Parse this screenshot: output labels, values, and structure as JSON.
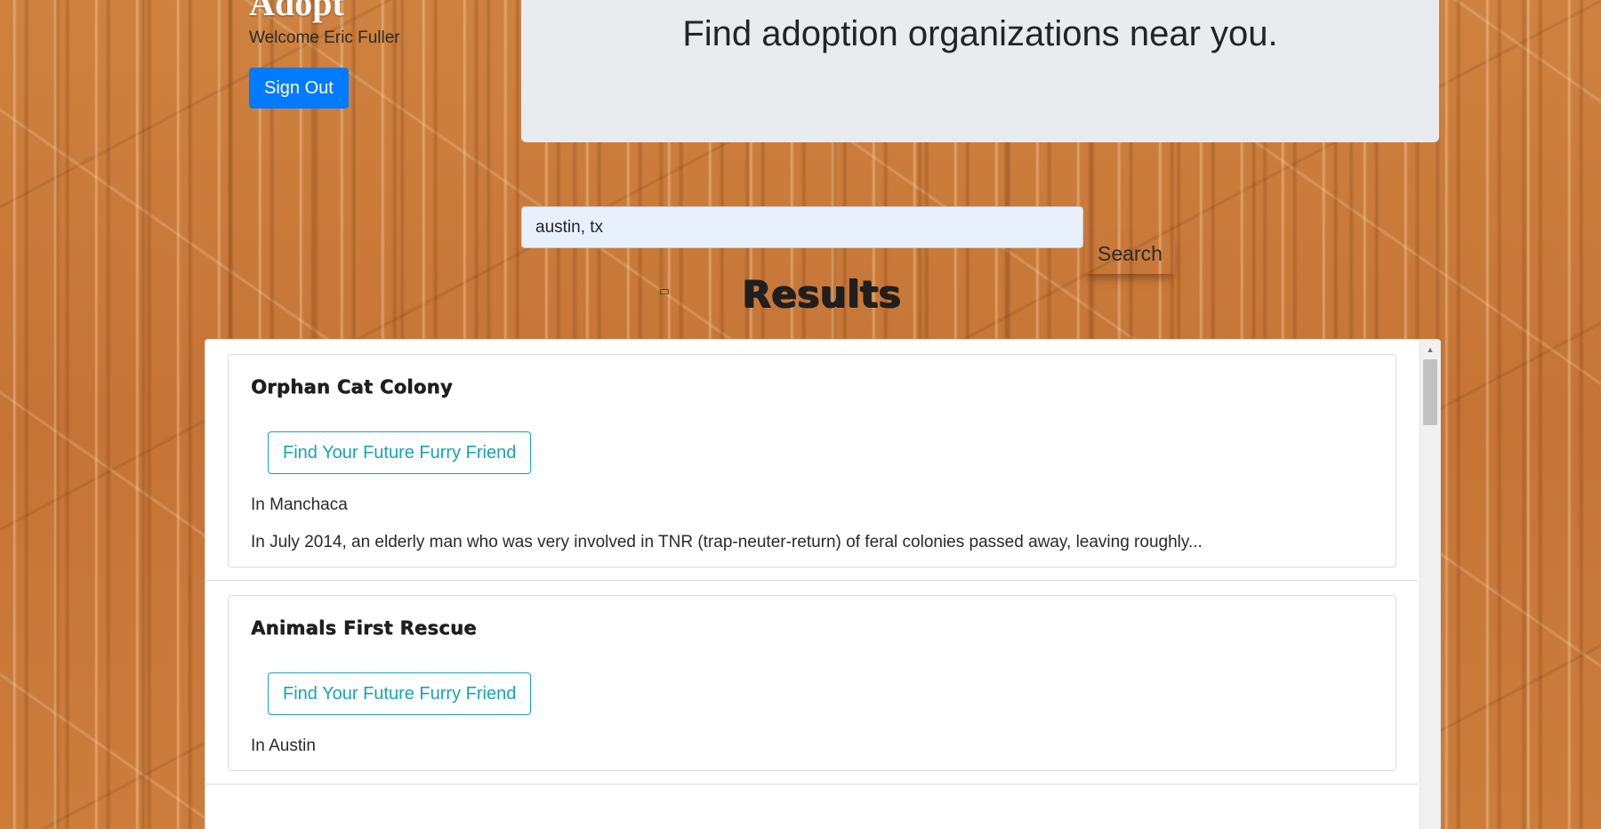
{
  "header": {
    "brand_title": "Adopt",
    "welcome_text": "Welcome Eric Fuller",
    "signout_label": "Sign Out"
  },
  "jumbotron": {
    "text": "Find adoption organizations near you."
  },
  "search": {
    "value": "austin, tx",
    "button_label": "Search"
  },
  "results": {
    "heading": "Results",
    "items": [
      {
        "name": "Orphan Cat Colony",
        "button_label": "Find Your Future Furry Friend",
        "location": "In Manchaca",
        "description": "In July 2014, an elderly man who was very involved in TNR (trap-neuter-return) of feral colonies passed away, leaving roughly..."
      },
      {
        "name": "Animals First Rescue",
        "button_label": "Find Your Future Furry Friend",
        "location": "In Austin"
      }
    ]
  },
  "scrollbar": {
    "up_arrow": "▲"
  },
  "colors": {
    "primary": "#007bff",
    "info": "#17a2b8",
    "jumbotron_bg": "#e9ecef",
    "input_bg": "#e8f0fe"
  },
  "icons": {
    "scroll_up": "scroll-up-arrow-icon"
  }
}
